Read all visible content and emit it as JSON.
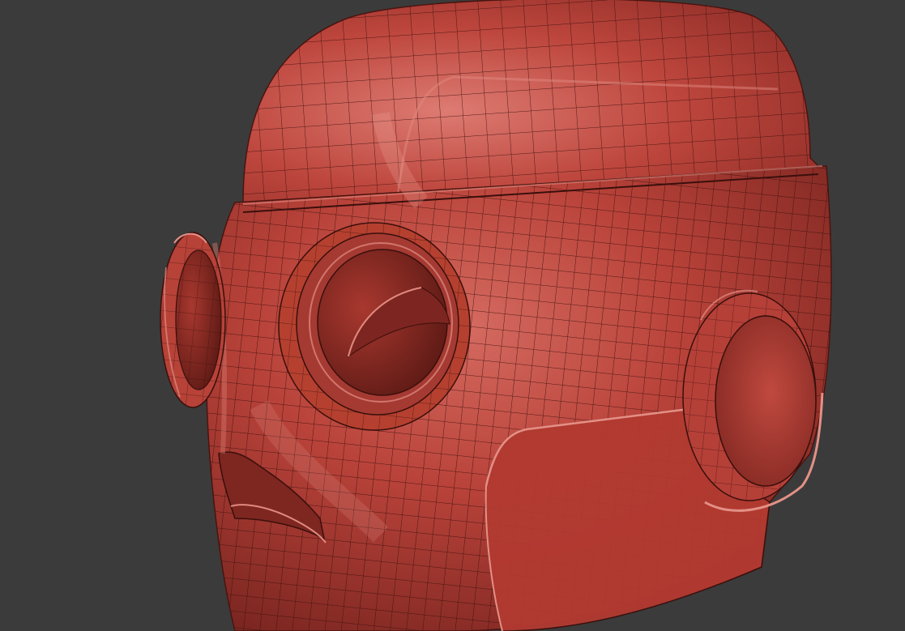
{
  "viewport": {
    "background_color": "#3b3b3b"
  },
  "model": {
    "description_icon": "robot-head-mesh",
    "base_color": "#b83c33",
    "highlight_color": "#d87066",
    "shadow_color": "#6a1d18",
    "wire_color": "#3a0f0c",
    "wireframe_visible": true
  }
}
